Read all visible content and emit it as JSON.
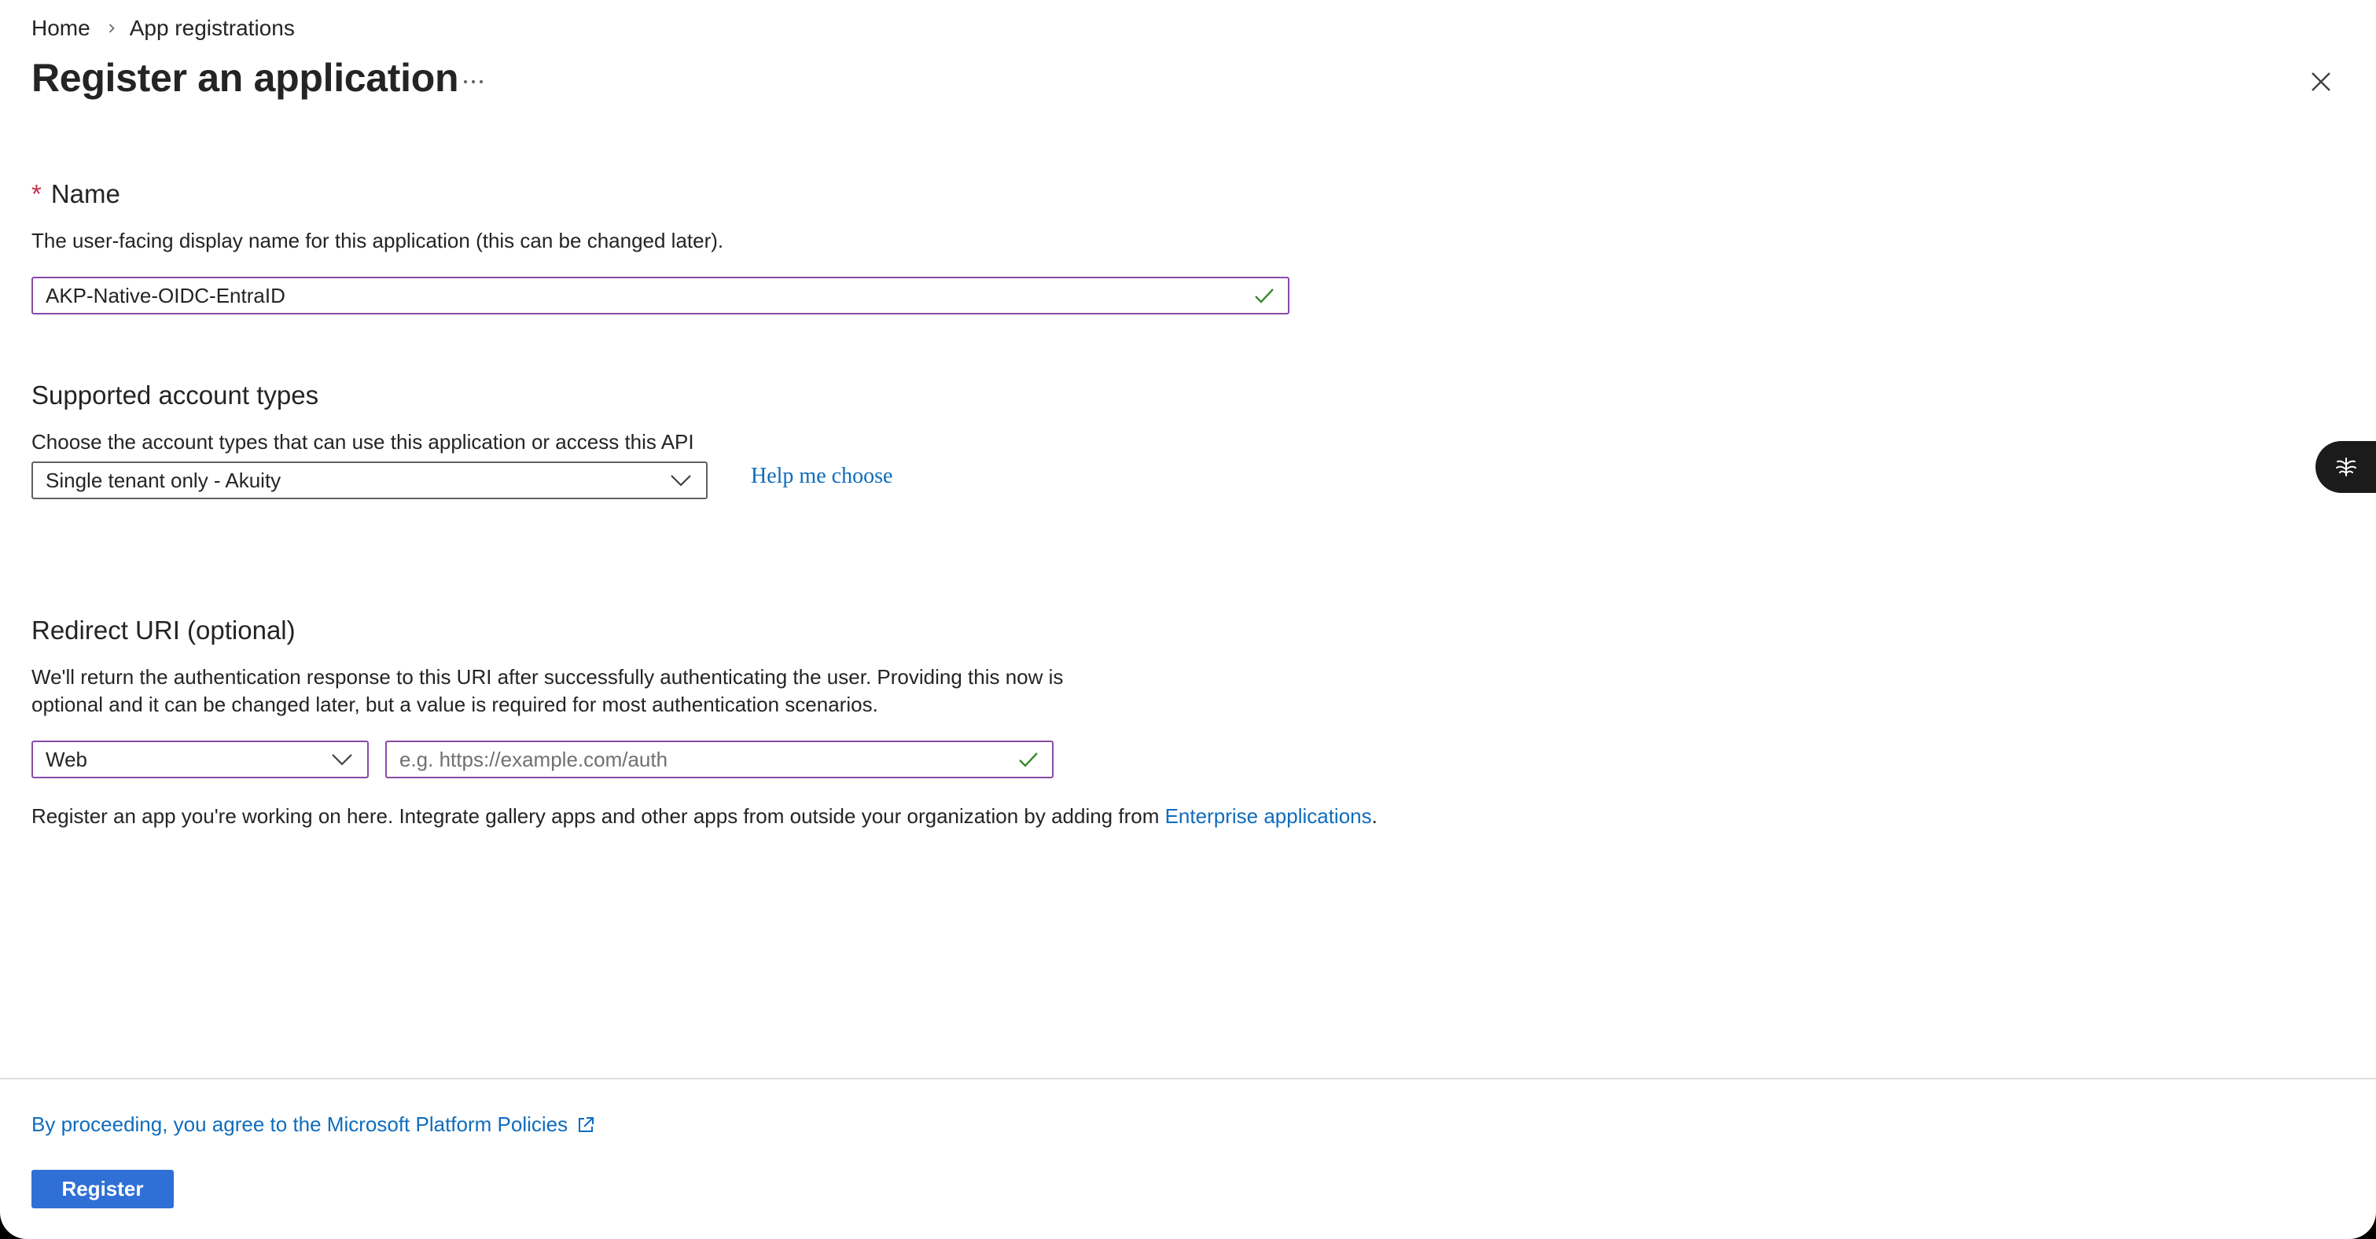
{
  "breadcrumb": {
    "items": [
      "Home",
      "App registrations"
    ]
  },
  "header": {
    "title": "Register an application",
    "more_label": "···"
  },
  "name_section": {
    "required_marker": "*",
    "label": "Name",
    "description": "The user-facing display name for this application (this can be changed later).",
    "input_value": "AKP-Native-OIDC-EntraID"
  },
  "account_section": {
    "label": "Supported account types",
    "description": "Choose the account types that can use this application or access this API",
    "selected": "Single tenant only - Akuity",
    "help_link": "Help me choose"
  },
  "redirect_section": {
    "label": "Redirect URI (optional)",
    "description_line1": "We'll return the authentication response to this URI after successfully authenticating the user. Providing this now is",
    "description_line2": "optional and it can be changed later, but a value is required for most authentication scenarios.",
    "platform_selected": "Web",
    "uri_placeholder": "e.g. https://example.com/auth"
  },
  "info": {
    "text": "Register an app you're working on here. Integrate gallery apps and other apps from outside your organization by adding from ",
    "link": "Enterprise applications",
    "suffix": "."
  },
  "footer": {
    "policy_link": "By proceeding, you agree to the Microsoft Platform Policies",
    "register_label": "Register"
  },
  "colors": {
    "accent": "#0f6cbd",
    "primary_button": "#2f6fd6",
    "focus_border": "#8a4aa6",
    "valid_check": "#3a8a2e",
    "required": "#c4314b"
  },
  "icons": {
    "breadcrumb_separator": "chevron-right-icon",
    "more": "more-icon",
    "close": "close-icon",
    "valid": "checkmark-icon",
    "dropdown": "chevron-down-icon",
    "external": "external-link-icon",
    "copilot": "copilot-icon"
  }
}
